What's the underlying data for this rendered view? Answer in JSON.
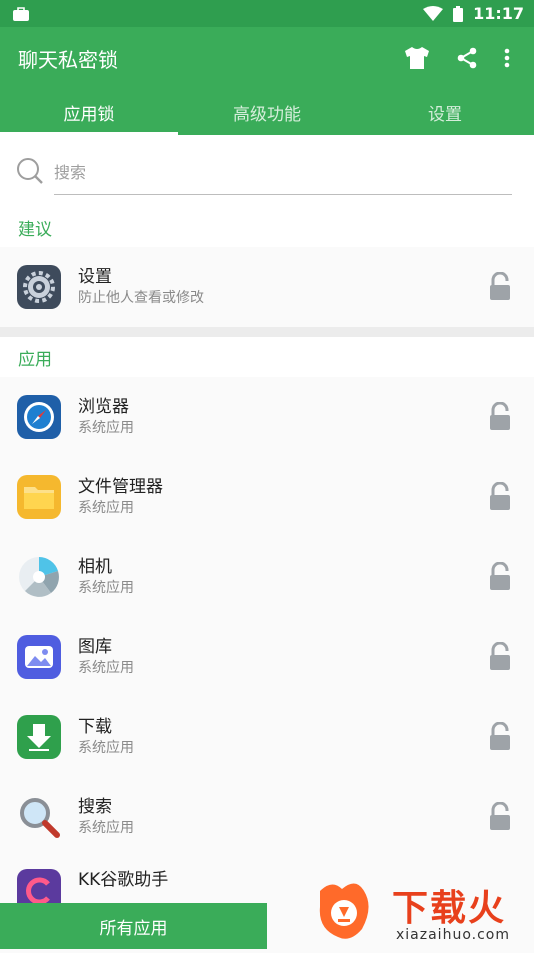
{
  "status": {
    "time": "11:17"
  },
  "appbar": {
    "title": "聊天私密锁"
  },
  "tabs": [
    {
      "label": "应用锁",
      "active": true
    },
    {
      "label": "高级功能",
      "active": false
    },
    {
      "label": "设置",
      "active": false
    }
  ],
  "search": {
    "placeholder": "搜索"
  },
  "suggest": {
    "header": "建议",
    "item": {
      "name": "设置",
      "sub": "防止他人查看或修改"
    }
  },
  "apps": {
    "header": "应用",
    "items": [
      {
        "name": "浏览器",
        "sub": "系统应用"
      },
      {
        "name": "文件管理器",
        "sub": "系统应用"
      },
      {
        "name": "相机",
        "sub": "系统应用"
      },
      {
        "name": "图库",
        "sub": "系统应用"
      },
      {
        "name": "下载",
        "sub": "系统应用"
      },
      {
        "name": "搜索",
        "sub": "系统应用"
      },
      {
        "name": "KK谷歌助手",
        "sub": ""
      }
    ]
  },
  "bottom": {
    "label": "所有应用"
  },
  "watermark": {
    "text1": "下载火",
    "text2": "xiazaihuo.com"
  },
  "colors": {
    "primary": "#3aac59",
    "status": "#2f9e4f",
    "lock": "#9ea3a8"
  }
}
